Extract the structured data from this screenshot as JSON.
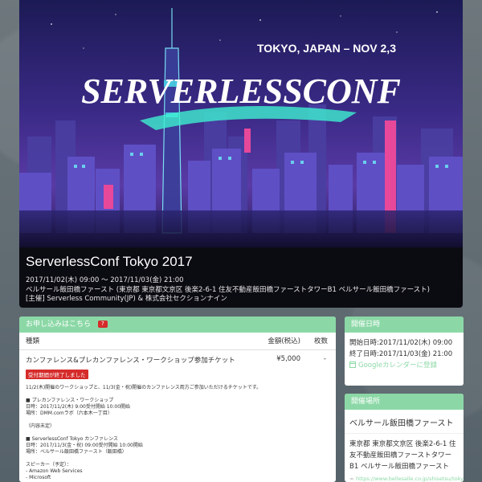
{
  "hero": {
    "location_tag": "TOKYO, JAPAN – NOV 2,3",
    "logo_text": "SERVERLESSCONF"
  },
  "event": {
    "title": "ServerlessConf Tokyo 2017",
    "datetime": "2017/11/02(木) 09:00 〜 2017/11/03(金) 21:00",
    "venue_line": "ベルサール飯田橋ファースト (東京都 東京都文京区 後楽2-6-1 住友不動産飯田橋ファーストタワーB1 ベルサール飯田橋ファースト)",
    "organizer_line": "[主催] Serverless Community(JP) & 株式会社セクションナイン"
  },
  "tickets": {
    "header": "お申し込みはこちら",
    "help_badge": "?",
    "columns": {
      "type": "種類",
      "price": "金額(税込)",
      "qty": "枚数"
    },
    "items": [
      {
        "name": "カンファレンス&プレカンファレンス・ワークショップ参加チケット",
        "price": "¥5,000",
        "qty": "-",
        "status": "受付期間が終了しました"
      }
    ],
    "description": [
      "11/2(木)開催のワークショップと、11/3(金・祝)開催のカンファレンス両方ご参加いただけるチケットです。",
      "",
      "■ プレカンファレンス・ワークショップ",
      "日時：2017/11/2(木) 9:00受付開始 10:00開始",
      "場所：DMM.comラボ（六本木一丁目）",
      "",
      "（内容未定）",
      "",
      "■ ServerlessConf Tokyo カンファレンス",
      "日時：2017/11/3(金・祝) 09:00受付開始 10:00開始",
      "場所：ベルサール飯田橋ファースト（飯田橋）",
      "",
      "スピーカー（予定）：",
      "- Amazon Web Services",
      "- Microsoft"
    ]
  },
  "dates": {
    "header": "開催日時",
    "start": "開始日時:2017/11/02(木) 09:00",
    "end": "終了日時:2017/11/03(金) 21:00",
    "calendar_link": "Googleカレンダーに登録"
  },
  "venue": {
    "header": "開催場所",
    "name": "ベルサール飯田橋ファースト",
    "address": "東京都 東京都文京区 後楽2-6-1 住友不動産飯田橋ファーストタワーB1 ベルサール飯田橋ファースト",
    "url": "https://www.bellesalle.co.jp/shisetsu/tokyo"
  },
  "colors": {
    "accent": "#8bd8a6",
    "danger": "#d62b2b",
    "hero_bg": "#0b0b12"
  }
}
